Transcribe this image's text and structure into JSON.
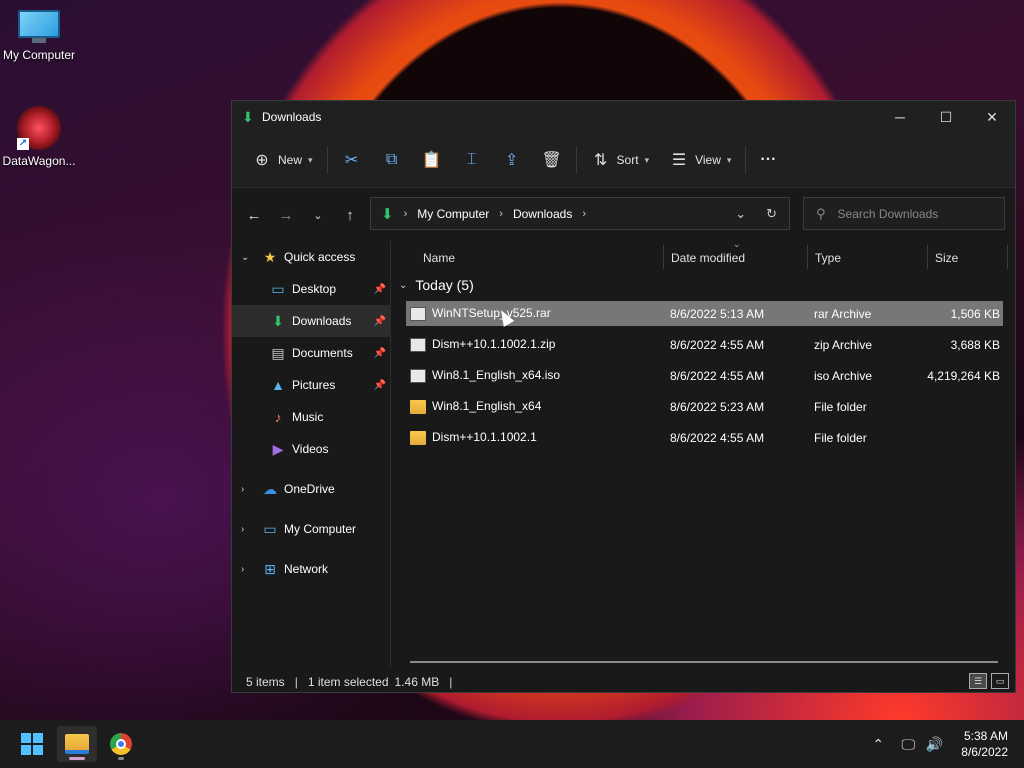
{
  "desktop": {
    "icons": [
      {
        "label": "My Computer"
      },
      {
        "label": "DataWagon..."
      }
    ]
  },
  "window": {
    "title": "Downloads",
    "controls": {
      "minimize": "─",
      "maximize": "☐",
      "close": "✕"
    }
  },
  "toolbar": {
    "new_label": "New",
    "sort_label": "Sort",
    "view_label": "View",
    "more_label": "···"
  },
  "address": {
    "crumbs": [
      "My Computer",
      "Downloads"
    ]
  },
  "search": {
    "placeholder": "Search Downloads"
  },
  "sidebar": {
    "items": [
      {
        "label": "Quick access",
        "icon": "star-icon"
      },
      {
        "label": "Desktop",
        "icon": "desktop-icon"
      },
      {
        "label": "Downloads",
        "icon": "download-icon"
      },
      {
        "label": "Documents",
        "icon": "documents-icon"
      },
      {
        "label": "Pictures",
        "icon": "pictures-icon"
      },
      {
        "label": "Music",
        "icon": "music-icon"
      },
      {
        "label": "Videos",
        "icon": "videos-icon"
      },
      {
        "label": "OneDrive",
        "icon": "cloud-icon"
      },
      {
        "label": "My Computer",
        "icon": "computer-icon"
      },
      {
        "label": "Network",
        "icon": "network-icon"
      }
    ]
  },
  "columns": {
    "name": "Name",
    "date": "Date modified",
    "type": "Type",
    "size": "Size"
  },
  "group": {
    "label": "Today (5)"
  },
  "files": [
    {
      "name": "WinNTSetup_v525.rar",
      "date": "8/6/2022 5:13 AM",
      "type": "rar Archive",
      "size": "1,506 KB",
      "kind": "archive"
    },
    {
      "name": "Dism++10.1.1002.1.zip",
      "date": "8/6/2022 4:55 AM",
      "type": "zip Archive",
      "size": "3,688 KB",
      "kind": "archive"
    },
    {
      "name": "Win8.1_English_x64.iso",
      "date": "8/6/2022 4:55 AM",
      "type": "iso Archive",
      "size": "4,219,264 KB",
      "kind": "archive"
    },
    {
      "name": "Win8.1_English_x64",
      "date": "8/6/2022 5:23 AM",
      "type": "File folder",
      "size": "",
      "kind": "folder"
    },
    {
      "name": "Dism++10.1.1002.1",
      "date": "8/6/2022 4:55 AM",
      "type": "File folder",
      "size": "",
      "kind": "folder"
    }
  ],
  "status": {
    "items": "5 items",
    "selected": "1 item selected",
    "selected_size": "1.46 MB"
  },
  "taskbar": {
    "time": "5:38 AM",
    "date": "8/6/2022"
  },
  "colors": {
    "accent": "#4cc2ff",
    "selection": "#777777",
    "window_bg": "#191919"
  }
}
